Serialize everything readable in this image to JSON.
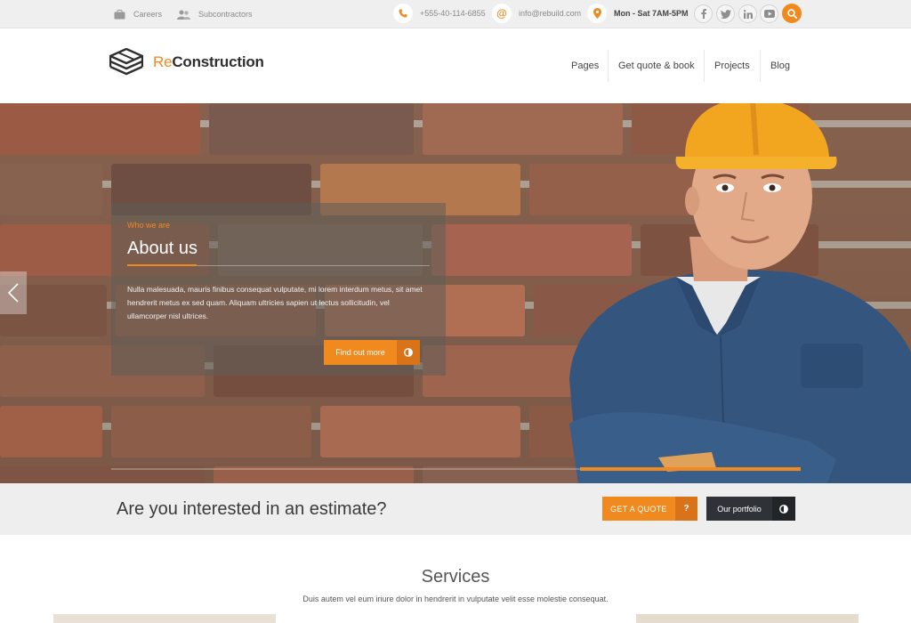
{
  "topbar": {
    "careers": "Careers",
    "subcontractors": "Subcontractors",
    "phone": "+555-40-114-6855",
    "email": "info@rebuild.com",
    "hours": "Mon - Sat 7AM-5PM",
    "social": [
      "facebook-icon",
      "twitter-icon",
      "linkedin-icon",
      "youtube-icon"
    ],
    "search_icon": "search-icon"
  },
  "logo": {
    "prefix": "Re",
    "suffix": "Construction"
  },
  "nav": {
    "items": [
      {
        "label": "Pages"
      },
      {
        "label": "Get quote & book"
      },
      {
        "label": "Projects"
      },
      {
        "label": "Blog"
      }
    ]
  },
  "hero": {
    "eyebrow": "Who we are",
    "title": "About us",
    "text": "Nulla malesuada, mauris finibus consequat vulputate, mi lorem interdum metus, sit amet hendrerit metus ex sed quam. Aliquam ultricies sapien ut lectus sollicitudin, vel ullamcorper nisl ultrices.",
    "button": "Find out more",
    "slide_progress": 0.32
  },
  "estimate": {
    "text": "Are you interested in an estimate?",
    "quote_button": "GET A QUOTE",
    "quote_icon": "?",
    "portfolio_button": "Our portfolio"
  },
  "services": {
    "title": "Services",
    "subtitle": "Duis autem vel eum iriure dolor in hendrerit in vulputate velit esse molestie consequat."
  },
  "colors": {
    "accent": "#f08a1f",
    "accent_dark": "#d9731a",
    "dark_button": "#2f3236",
    "topbar": "#efefef",
    "band": "#eeeeee"
  }
}
